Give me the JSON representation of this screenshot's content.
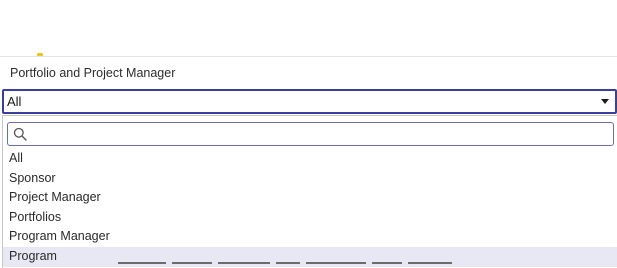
{
  "field": {
    "label": "Portfolio and Project Manager",
    "selected_value": "All"
  },
  "search": {
    "placeholder": "",
    "value": ""
  },
  "options": [
    {
      "label": "All"
    },
    {
      "label": "Sponsor"
    },
    {
      "label": "Project Manager"
    },
    {
      "label": "Portfolios"
    },
    {
      "label": "Program Manager"
    },
    {
      "label": "Program",
      "highlighted": true
    }
  ],
  "icons": {
    "search": "search-icon",
    "caret": "chevron-down-icon"
  },
  "colors": {
    "focus_border": "#3a3f9e",
    "search_border": "#6a6fb5",
    "highlight_row": "#e7e8f4"
  }
}
